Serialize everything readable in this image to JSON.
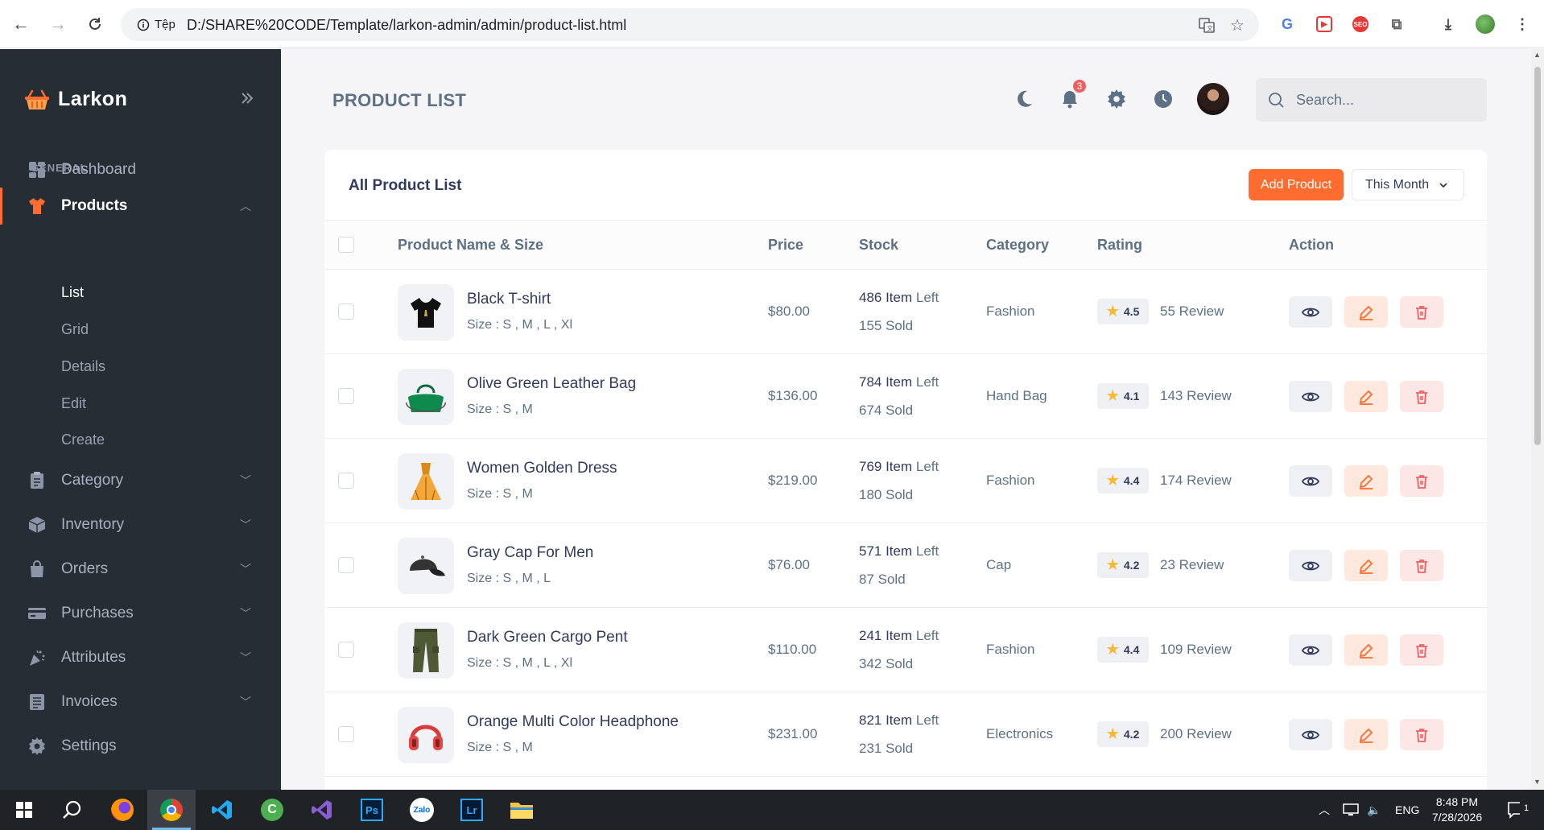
{
  "browser": {
    "site_label": "Tệp",
    "url": "D:/SHARE%20CODE/Template/larkon-admin/admin/product-list.html"
  },
  "sidebar": {
    "brand": "Larkon",
    "section": "GENERAL",
    "items": [
      {
        "label": "Dashboard",
        "icon": "dashboard-icon"
      },
      {
        "label": "Products",
        "icon": "tshirt-icon",
        "active": true
      },
      {
        "label": "Category",
        "icon": "clipboard-icon"
      },
      {
        "label": "Inventory",
        "icon": "box-icon"
      },
      {
        "label": "Orders",
        "icon": "bag-icon"
      },
      {
        "label": "Purchases",
        "icon": "card-icon"
      },
      {
        "label": "Attributes",
        "icon": "confetti-icon"
      },
      {
        "label": "Invoices",
        "icon": "invoice-icon"
      },
      {
        "label": "Settings",
        "icon": "gear-icon"
      }
    ],
    "product_sub": [
      "List",
      "Grid",
      "Details",
      "Edit",
      "Create"
    ]
  },
  "topbar": {
    "title": "PRODUCT LIST",
    "notifications": "3",
    "search_placeholder": "Search..."
  },
  "card": {
    "title": "All Product List",
    "add_button": "Add Product",
    "period": "This Month",
    "columns": [
      "Product Name & Size",
      "Price",
      "Stock",
      "Category",
      "Rating",
      "Action"
    ]
  },
  "products": [
    {
      "name": "Black T-shirt",
      "size": "Size : S , M , L , Xl",
      "price": "$80.00",
      "stock": "486 Item",
      "left": "Left",
      "sold": "155 Sold",
      "category": "Fashion",
      "rating": "4.5",
      "reviews": "55 Review",
      "thumb": "tshirt"
    },
    {
      "name": "Olive Green Leather Bag",
      "size": "Size : S , M",
      "price": "$136.00",
      "stock": "784 Item",
      "left": "Left",
      "sold": "674 Sold",
      "category": "Hand Bag",
      "rating": "4.1",
      "reviews": "143 Review",
      "thumb": "bag"
    },
    {
      "name": "Women Golden Dress",
      "size": "Size : S , M",
      "price": "$219.00",
      "stock": "769 Item",
      "left": "Left",
      "sold": "180 Sold",
      "category": "Fashion",
      "rating": "4.4",
      "reviews": "174 Review",
      "thumb": "dress"
    },
    {
      "name": "Gray Cap For Men",
      "size": "Size : S , M , L",
      "price": "$76.00",
      "stock": "571 Item",
      "left": "Left",
      "sold": "87 Sold",
      "category": "Cap",
      "rating": "4.2",
      "reviews": "23 Review",
      "thumb": "cap"
    },
    {
      "name": "Dark Green Cargo Pent",
      "size": "Size : S , M , L , Xl",
      "price": "$110.00",
      "stock": "241 Item",
      "left": "Left",
      "sold": "342 Sold",
      "category": "Fashion",
      "rating": "4.4",
      "reviews": "109 Review",
      "thumb": "pants"
    },
    {
      "name": "Orange Multi Color Headphone",
      "size": "Size : S , M",
      "price": "$231.00",
      "stock": "821 Item",
      "left": "Left",
      "sold": "231 Sold",
      "category": "Electronics",
      "rating": "4.2",
      "reviews": "200 Review",
      "thumb": "headphone"
    }
  ],
  "taskbar": {
    "apps": [
      "windows-start",
      "search",
      "firefox",
      "chrome",
      "vscode",
      "app-green",
      "visual-studio",
      "photoshop",
      "zalo",
      "lightroom",
      "file-explorer"
    ],
    "language": "ENG",
    "time": "8:48 PM",
    "date": "7/28/2026",
    "notification_count": "1"
  },
  "colors": {
    "accent": "#ff6c2f",
    "sidebar": "#262d34",
    "star": "#f9b931"
  }
}
